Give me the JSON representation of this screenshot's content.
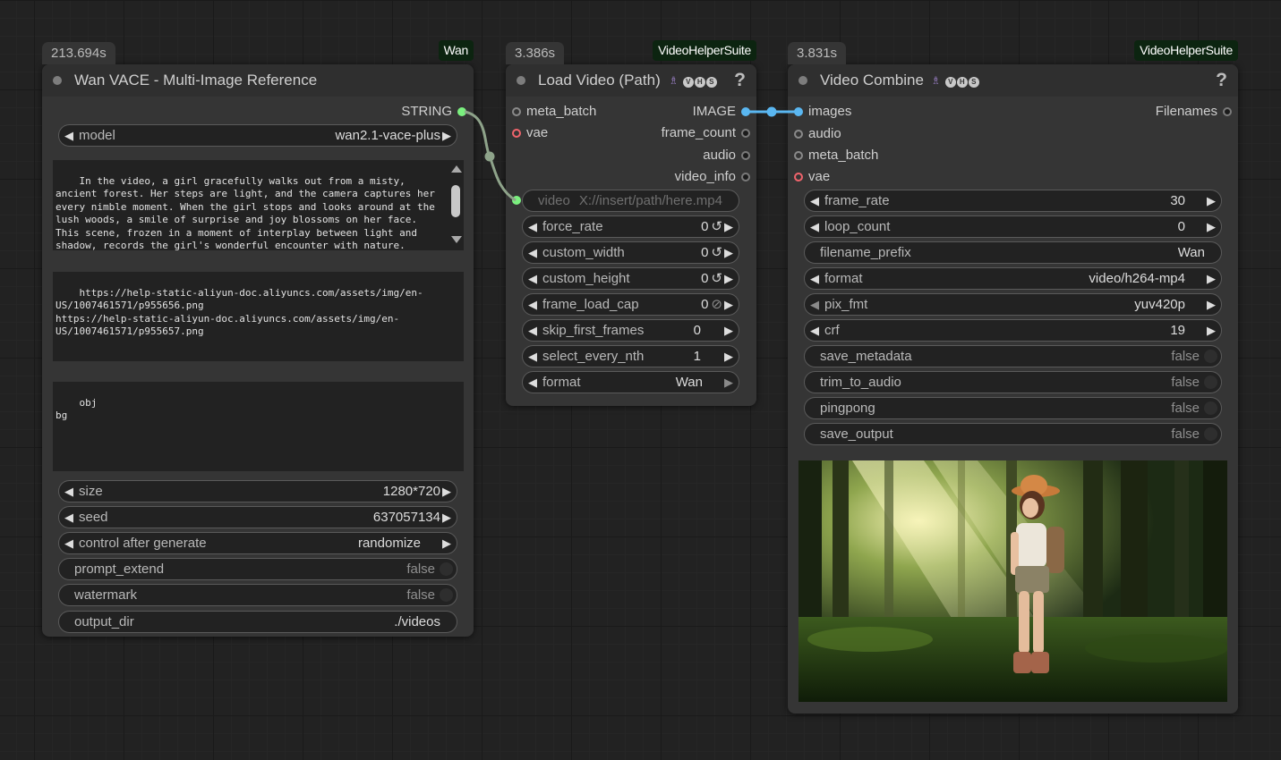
{
  "nodes": {
    "wan": {
      "time": "213.694s",
      "source": "Wan",
      "title": "Wan VACE - Multi-Image Reference",
      "output_label": "STRING",
      "model": {
        "label": "model",
        "value": "wan2.1-vace-plus"
      },
      "prompt": "In the video, a girl gracefully walks out from a misty, ancient forest. Her steps are light, and the camera captures her every nimble moment. When the girl stops and looks around at the lush woods, a smile of surprise and joy blossoms on her face. This scene, frozen in a moment of interplay between light and shadow, records the girl's wonderful encounter with nature.",
      "urls": "https://help-static-aliyun-doc.aliyuncs.com/assets/img/en-US/1007461571/p955656.png\nhttps://help-static-aliyun-doc.aliyuncs.com/assets/img/en-US/1007461571/p955657.png",
      "ref_types": "obj\nbg",
      "size": {
        "label": "size",
        "value": "1280*720"
      },
      "seed": {
        "label": "seed",
        "value": "637057134"
      },
      "control": {
        "label": "control after generate",
        "value": "randomize"
      },
      "prompt_extend": {
        "label": "prompt_extend",
        "value": "false"
      },
      "watermark": {
        "label": "watermark",
        "value": "false"
      },
      "output_dir": {
        "label": "output_dir",
        "value": "./videos"
      }
    },
    "load": {
      "time": "3.386s",
      "source": "VideoHelperSuite",
      "title": "Load Video (Path)",
      "help": "?",
      "inputs": {
        "meta_batch": "meta_batch",
        "vae": "vae"
      },
      "outputs": {
        "image": "IMAGE",
        "frame_count": "frame_count",
        "audio": "audio",
        "video_info": "video_info"
      },
      "video": {
        "label": "video",
        "placeholder": "X://insert/path/here.mp4"
      },
      "force_rate": {
        "label": "force_rate",
        "value": "0"
      },
      "custom_width": {
        "label": "custom_width",
        "value": "0"
      },
      "custom_height": {
        "label": "custom_height",
        "value": "0"
      },
      "frame_load_cap": {
        "label": "frame_load_cap",
        "value": "0"
      },
      "skip_first_frames": {
        "label": "skip_first_frames",
        "value": "0"
      },
      "select_every_nth": {
        "label": "select_every_nth",
        "value": "1"
      },
      "format": {
        "label": "format",
        "value": "Wan"
      }
    },
    "combine": {
      "time": "3.831s",
      "source": "VideoHelperSuite",
      "title": "Video Combine",
      "help": "?",
      "inputs": {
        "images": "images",
        "audio": "audio",
        "meta_batch": "meta_batch",
        "vae": "vae"
      },
      "outputs": {
        "filenames": "Filenames"
      },
      "frame_rate": {
        "label": "frame_rate",
        "value": "30"
      },
      "loop_count": {
        "label": "loop_count",
        "value": "0"
      },
      "filename_prefix": {
        "label": "filename_prefix",
        "value": "Wan"
      },
      "format": {
        "label": "format",
        "value": "video/h264-mp4"
      },
      "pix_fmt": {
        "label": "pix_fmt",
        "value": "yuv420p"
      },
      "crf": {
        "label": "crf",
        "value": "19"
      },
      "save_metadata": {
        "label": "save_metadata",
        "value": "false"
      },
      "trim_to_audio": {
        "label": "trim_to_audio",
        "value": "false"
      },
      "pingpong": {
        "label": "pingpong",
        "value": "false"
      },
      "save_output": {
        "label": "save_output",
        "value": "false"
      }
    }
  },
  "colors": {
    "canvas": "#222222",
    "node_body": "#353535",
    "node_header": "#2f2f2f",
    "source_badge": "#0c2410",
    "string_link": "#7bf07f",
    "image_link": "#5ab7f1",
    "vae_slot": "#f0646c"
  }
}
